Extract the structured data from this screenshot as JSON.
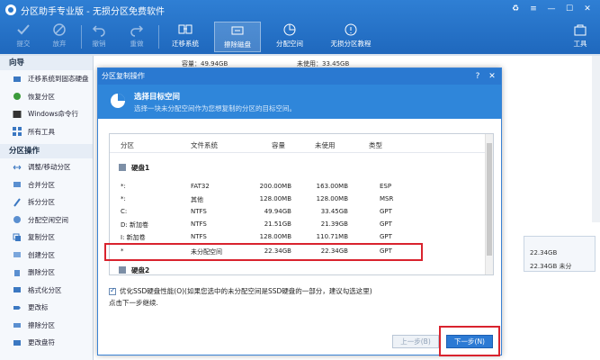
{
  "app": {
    "title": "分区助手专业版 - 无损分区免费软件"
  },
  "toolbar": {
    "items": [
      {
        "label": "提交",
        "icon": "check-icon",
        "disabled": true
      },
      {
        "label": "放弃",
        "icon": "cancel-icon",
        "disabled": true
      },
      {
        "label": "撤销",
        "icon": "undo-icon",
        "disabled": true
      },
      {
        "label": "重做",
        "icon": "redo-icon",
        "disabled": true
      },
      {
        "label": "迁移系统",
        "icon": "migrate-icon",
        "disabled": false
      },
      {
        "label": "擦除磁盘",
        "icon": "wipe-disk-icon",
        "disabled": false
      },
      {
        "label": "分配空间",
        "icon": "allocate-icon",
        "disabled": false
      },
      {
        "label": "无损分区教程",
        "icon": "tutorial-icon",
        "disabled": false
      }
    ],
    "tools_label": "工具"
  },
  "sidebar": {
    "wizard_title": "向导",
    "wizard_items": [
      "迁移系统到固态硬盘",
      "恢复分区",
      "Windows命令行",
      "所有工具"
    ],
    "ops_title": "分区操作",
    "ops_items": [
      "调整/移动分区",
      "合并分区",
      "拆分分区",
      "分配空闲空间",
      "复制分区",
      "创建分区",
      "删除分区",
      "格式化分区",
      "更改标",
      "擦除分区",
      "更改盘符"
    ]
  },
  "background": {
    "cap_text": "容量：49.94GB",
    "free_text": "未使用：33.45GB",
    "disk_cap": "22.34GB",
    "disk_text": "22.34GB 未分"
  },
  "dialog": {
    "title": "分区复制操作",
    "header_title": "选择目标空间",
    "header_subtitle": "选择一块未分配空间作为您想复制的分区的目标空间。",
    "columns": {
      "partition": "分区",
      "fs": "文件系统",
      "capacity": "容量",
      "free": "未使用",
      "type": "类型"
    },
    "disk1": "硬盘1",
    "disk2": "硬盘2",
    "rows": [
      {
        "part": "*:",
        "fs": "FAT32",
        "cap": "200.00MB",
        "free": "163.00MB",
        "type": "ESP"
      },
      {
        "part": "*:",
        "fs": "其他",
        "cap": "128.00MB",
        "free": "128.00MB",
        "type": "MSR"
      },
      {
        "part": "C:",
        "fs": "NTFS",
        "cap": "49.94GB",
        "free": "33.45GB",
        "type": "GPT"
      },
      {
        "part": "D: 新加卷",
        "fs": "NTFS",
        "cap": "21.51GB",
        "free": "21.39GB",
        "type": "GPT"
      },
      {
        "part": "I: 新加卷",
        "fs": "NTFS",
        "cap": "128.00MB",
        "free": "110.71MB",
        "type": "GPT"
      },
      {
        "part": "*",
        "fs": "未分配空间",
        "cap": "22.34GB",
        "free": "22.34GB",
        "type": "GPT"
      }
    ],
    "option_label": "优化SSD硬盘性能(O)(如果您选中的未分配空间是SSD硬盘的一部分，建议勾选这里)",
    "hint": "点击下一步继续.",
    "prev_label": "上一步(B)",
    "next_label": "下一步(N)"
  },
  "colors": {
    "accent": "#2a79d1",
    "highlight": "#d9232e"
  }
}
